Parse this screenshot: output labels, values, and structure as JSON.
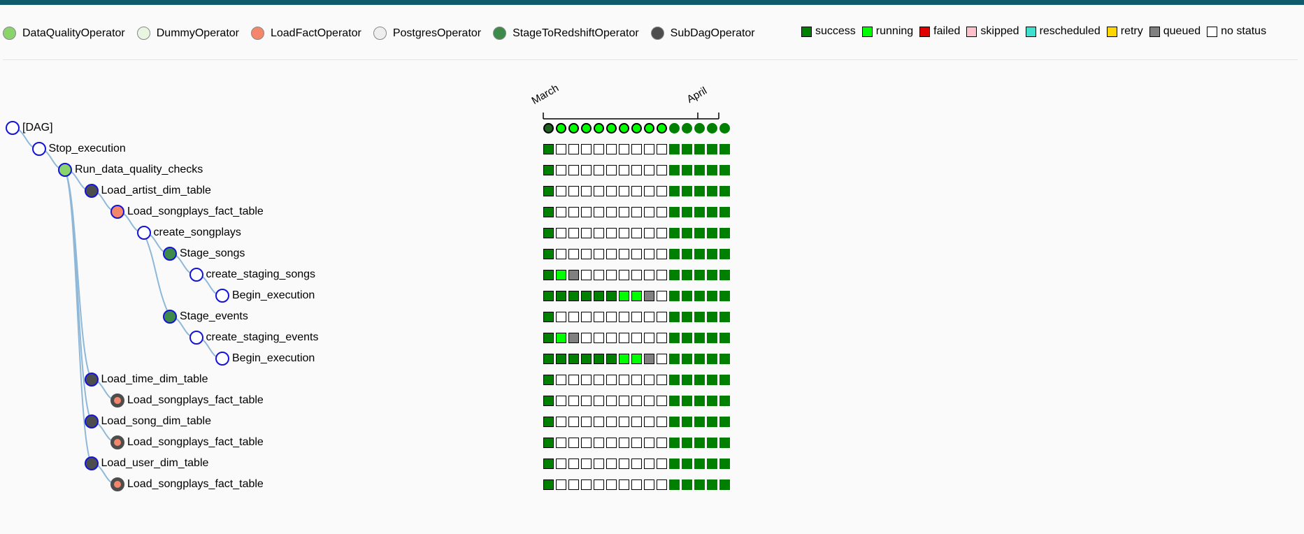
{
  "colors": {
    "success": "#008000",
    "running": "#00ff00",
    "failed": "#e00000",
    "skipped": "#ffc0cb",
    "rescheduled": "#40e0d0",
    "retry": "#ffd700",
    "queued": "#808080",
    "no_status": "#ffffff",
    "tree_border": "#1414d8",
    "link": "#8fb8d8"
  },
  "operator_legend": [
    {
      "label": "DataQualityOperator",
      "color": "#8bd36b"
    },
    {
      "label": "DummyOperator",
      "color": "#e8f5e0"
    },
    {
      "label": "LoadFactOperator",
      "color": "#f4876a"
    },
    {
      "label": "PostgresOperator",
      "color": "#eeeeee"
    },
    {
      "label": "StageToRedshiftOperator",
      "color": "#3e8a4a"
    },
    {
      "label": "SubDagOperator",
      "color": "#4d4d4d"
    }
  ],
  "state_legend": [
    {
      "label": "success",
      "color": "#008000"
    },
    {
      "label": "running",
      "color": "#00ff00"
    },
    {
      "label": "failed",
      "color": "#e00000"
    },
    {
      "label": "skipped",
      "color": "#ffc0cb"
    },
    {
      "label": "rescheduled",
      "color": "#40e0d0"
    },
    {
      "label": "retry",
      "color": "#ffd700"
    },
    {
      "label": "queued",
      "color": "#808080"
    },
    {
      "label": "no status",
      "color": "#ffffff"
    }
  ],
  "months": [
    "March",
    "April"
  ],
  "dag_runs": [
    "success",
    "running",
    "running",
    "running",
    "running",
    "running",
    "running",
    "running",
    "running",
    "running",
    "success",
    "success",
    "success",
    "success",
    "success"
  ],
  "tasks": [
    {
      "label": "[DAG]",
      "depth": 0,
      "fill": "#ffffff",
      "subdag": false,
      "parent": null,
      "states": "D"
    },
    {
      "label": "Stop_execution",
      "depth": 1,
      "fill": "#ffffff",
      "subdag": false,
      "parent": 0,
      "states": "snnnnnnnnnsssss"
    },
    {
      "label": "Run_data_quality_checks",
      "depth": 2,
      "fill": "#8bd36b",
      "subdag": false,
      "parent": 1,
      "states": "snnnnnnnnnsssss"
    },
    {
      "label": "Load_artist_dim_table",
      "depth": 3,
      "fill": "#4d4d4d",
      "subdag": false,
      "parent": 2,
      "states": "snnnnnnnnnsssss"
    },
    {
      "label": "Load_songplays_fact_table",
      "depth": 4,
      "fill": "#f4876a",
      "subdag": false,
      "parent": 3,
      "states": "snnnnnnnnnsssss"
    },
    {
      "label": "create_songplays",
      "depth": 5,
      "fill": "#ffffff",
      "subdag": false,
      "parent": 4,
      "states": "snnnnnnnnnsssss"
    },
    {
      "label": "Stage_songs",
      "depth": 6,
      "fill": "#3e8a4a",
      "subdag": false,
      "parent": 5,
      "states": "snnnnnnnnnsssss"
    },
    {
      "label": "create_staging_songs",
      "depth": 7,
      "fill": "#ffffff",
      "subdag": false,
      "parent": 6,
      "states": "srqnnnnnnnsssss"
    },
    {
      "label": "Begin_execution",
      "depth": 8,
      "fill": "#ffffff",
      "subdag": false,
      "parent": 7,
      "states": "ssssssrrqnsssss"
    },
    {
      "label": "Stage_events",
      "depth": 6,
      "fill": "#3e8a4a",
      "subdag": false,
      "parent": 5,
      "states": "snnnnnnnnnsssss"
    },
    {
      "label": "create_staging_events",
      "depth": 7,
      "fill": "#ffffff",
      "subdag": false,
      "parent": 9,
      "states": "srqnnnnnnnsssss"
    },
    {
      "label": "Begin_execution",
      "depth": 8,
      "fill": "#ffffff",
      "subdag": false,
      "parent": 10,
      "states": "ssssssrrqnsssss"
    },
    {
      "label": "Load_time_dim_table",
      "depth": 3,
      "fill": "#4d4d4d",
      "subdag": false,
      "parent": 2,
      "states": "snnnnnnnnnsssss"
    },
    {
      "label": "Load_songplays_fact_table",
      "depth": 4,
      "fill": "#f4876a",
      "subdag": true,
      "parent": 12,
      "states": "snnnnnnnnnsssss"
    },
    {
      "label": "Load_song_dim_table",
      "depth": 3,
      "fill": "#4d4d4d",
      "subdag": false,
      "parent": 2,
      "states": "snnnnnnnnnsssss"
    },
    {
      "label": "Load_songplays_fact_table",
      "depth": 4,
      "fill": "#f4876a",
      "subdag": true,
      "parent": 14,
      "states": "snnnnnnnnnsssss"
    },
    {
      "label": "Load_user_dim_table",
      "depth": 3,
      "fill": "#4d4d4d",
      "subdag": false,
      "parent": 2,
      "states": "snnnnnnnnnsssss"
    },
    {
      "label": "Load_songplays_fact_table",
      "depth": 4,
      "fill": "#f4876a",
      "subdag": true,
      "parent": 16,
      "states": "snnnnnnnnnsssss"
    }
  ]
}
